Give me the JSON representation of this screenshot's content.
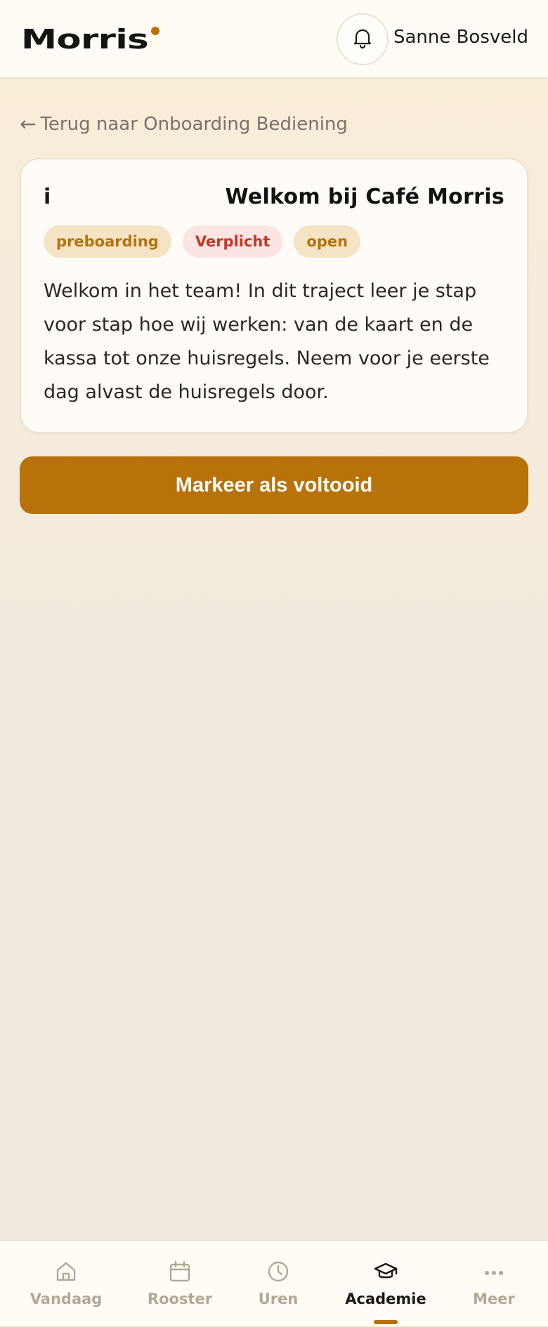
{
  "header": {
    "logo_text": "Morris",
    "user_name": "Sanne Bosveld",
    "bell_icon": "bell-icon"
  },
  "back_link": {
    "arrow": "←",
    "label": "Terug naar Onboarding Bediening"
  },
  "card": {
    "icon_glyph": "i",
    "title": "Welkom bij Café Morris",
    "badges": {
      "phase": "preboarding",
      "required": "Verplicht",
      "status": "open"
    },
    "body": "Welkom in het team! In dit traject leer je stap voor stap hoe wij werken: van de kaart en de kassa tot onze huisregels. Neem voor je eerste dag alvast de huisregels door."
  },
  "complete_button": {
    "label": "Markeer als voltooid"
  },
  "bottom_nav": {
    "items": [
      {
        "label": "Vandaag",
        "icon": "home-icon"
      },
      {
        "label": "Rooster",
        "icon": "calendar-icon"
      },
      {
        "label": "Uren",
        "icon": "clock-icon"
      },
      {
        "label": "Academie",
        "icon": "graduation-cap-icon",
        "active": true
      },
      {
        "label": "Meer",
        "icon": "more-icon"
      }
    ]
  },
  "colors": {
    "accent": "#b8720a",
    "required_text": "#c0392b",
    "inactive_nav": "#b1a895"
  }
}
